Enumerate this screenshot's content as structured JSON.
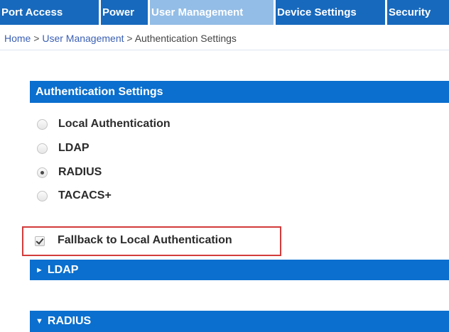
{
  "nav": {
    "tabs": [
      {
        "label": "Port Access",
        "active": false
      },
      {
        "label": "Power",
        "active": false
      },
      {
        "label": "User Management",
        "active": true
      },
      {
        "label": "Device Settings",
        "active": false
      },
      {
        "label": "Security",
        "active": false
      }
    ]
  },
  "breadcrumb": {
    "home": "Home",
    "separator": " > ",
    "section": "User Management",
    "current": "Authentication Settings"
  },
  "auth_settings": {
    "title": "Authentication Settings",
    "options": [
      {
        "label": "Local Authentication",
        "checked": false
      },
      {
        "label": "LDAP",
        "checked": false
      },
      {
        "label": "RADIUS",
        "checked": true
      },
      {
        "label": "TACACS+",
        "checked": false
      }
    ],
    "fallback": {
      "label": "Fallback to Local Authentication",
      "checked": true
    }
  },
  "sections": {
    "ldap": {
      "label": "LDAP",
      "icon": "triangle-right-icon",
      "expanded": false
    },
    "radius": {
      "label": "RADIUS",
      "icon": "triangle-down-icon",
      "expanded": true
    }
  },
  "colors": {
    "tab_bg": "#1769bd",
    "tab_active_bg": "#93bde6",
    "section_bar": "#0a6fce",
    "highlight_border": "#d23b3b",
    "link": "#3a5fb3"
  }
}
